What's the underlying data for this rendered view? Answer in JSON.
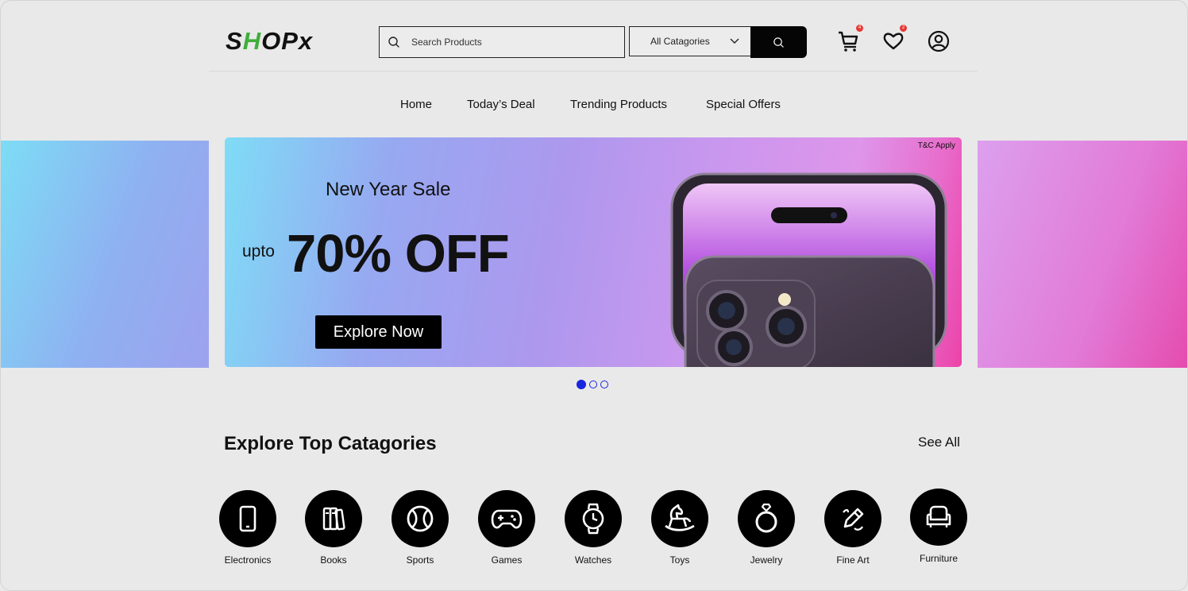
{
  "header": {
    "logo": {
      "part1": "S",
      "part2": "H",
      "part3": "O",
      "part4": "P",
      "part5": "x"
    },
    "search": {
      "placeholder": "Search Products",
      "value": ""
    },
    "category_select": "All Catagories",
    "cart_count": "4",
    "wishlist_count": "2",
    "icons": [
      "search-icon",
      "chevron-down-icon",
      "cart-icon",
      "heart-icon",
      "user-icon"
    ]
  },
  "nav": {
    "items": [
      {
        "label": "Home"
      },
      {
        "label": "Today’s Deal"
      },
      {
        "label": "Trending Products"
      },
      {
        "label": "Special Offers"
      }
    ]
  },
  "hero": {
    "tnc": "T&C Apply",
    "subtitle": "New Year Sale",
    "upto": "upto",
    "discount": "70% OFF",
    "cta": "Explore Now",
    "slide_count": 3,
    "active_slide": 1
  },
  "categories": {
    "title": "Explore Top Catagories",
    "see_all": "See All",
    "items": [
      {
        "label": "Electronics",
        "icon": "smartphone-icon"
      },
      {
        "label": "Books",
        "icon": "books-icon"
      },
      {
        "label": "Sports",
        "icon": "tennis-ball-icon"
      },
      {
        "label": "Games",
        "icon": "gamepad-icon"
      },
      {
        "label": "Watches",
        "icon": "watch-icon"
      },
      {
        "label": "Toys",
        "icon": "rocking-horse-icon"
      },
      {
        "label": "Jewelry",
        "icon": "ring-icon"
      },
      {
        "label": "Fine Art",
        "icon": "pen-tool-icon"
      },
      {
        "label": "Furniture",
        "icon": "sofa-icon"
      }
    ]
  },
  "colors": {
    "accent_green": "#3fae3a",
    "dot_blue": "#1826e0",
    "badge_red": "#e53935"
  }
}
